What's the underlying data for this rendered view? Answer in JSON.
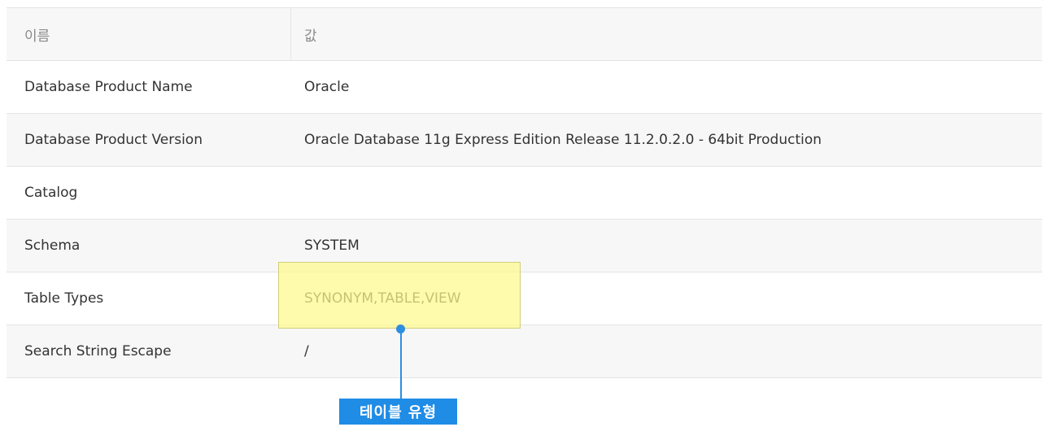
{
  "table": {
    "header": {
      "name": "이름",
      "value": "값"
    },
    "rows": [
      {
        "name": "Database Product Name",
        "value": "Oracle"
      },
      {
        "name": "Database Product Version",
        "value": "Oracle Database 11g Express Edition Release 11.2.0.2.0 - 64bit Production"
      },
      {
        "name": "Catalog",
        "value": ""
      },
      {
        "name": "Schema",
        "value": "SYSTEM"
      },
      {
        "name": "Table Types",
        "value": "SYNONYM,TABLE,VIEW"
      },
      {
        "name": "Search String Escape",
        "value": "/"
      }
    ]
  },
  "annotation": {
    "label": "테이블 유형",
    "highlight_color": "#fffa8c",
    "accent_color": "#1f8ce6"
  }
}
